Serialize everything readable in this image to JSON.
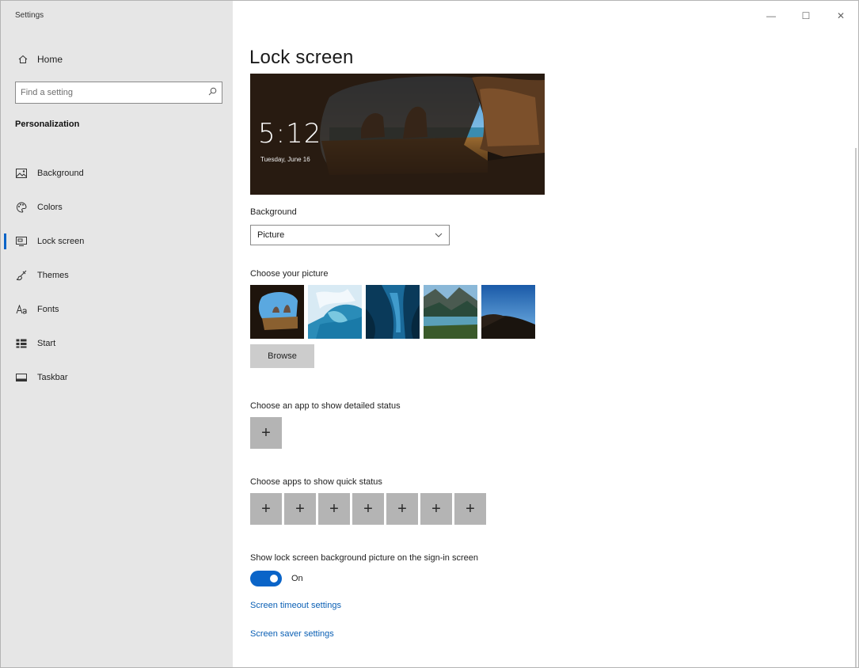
{
  "window": {
    "app_title": "Settings"
  },
  "title_bar": {
    "minimize": "—",
    "maximize": "☐",
    "close": "✕"
  },
  "sidebar": {
    "home_label": "Home",
    "search_placeholder": "Find a setting",
    "section_title": "Personalization",
    "items": [
      {
        "label": "Background",
        "icon": "image-icon"
      },
      {
        "label": "Colors",
        "icon": "palette-icon"
      },
      {
        "label": "Lock screen",
        "icon": "lock-screen-icon",
        "active": true
      },
      {
        "label": "Themes",
        "icon": "brush-icon"
      },
      {
        "label": "Fonts",
        "icon": "font-icon"
      },
      {
        "label": "Start",
        "icon": "start-icon"
      },
      {
        "label": "Taskbar",
        "icon": "taskbar-icon"
      }
    ]
  },
  "main": {
    "title": "Lock screen",
    "preview": {
      "time": "5:12",
      "date": "Tuesday, June 16"
    },
    "background_label": "Background",
    "background_value": "Picture",
    "choose_picture_label": "Choose your picture",
    "browse_label": "Browse",
    "detailed_status_label": "Choose an app to show detailed status",
    "quick_status_label": "Choose apps to show quick status",
    "plus_symbol": "+",
    "show_bg_label": "Show lock screen background picture on the sign-in screen",
    "toggle_state": "On",
    "link_timeout": "Screen timeout settings",
    "link_saver": "Screen saver settings"
  },
  "colors": {
    "accent": "#0a64c8",
    "sidebar_bg": "#e6e6e6",
    "link": "#0a5fb4",
    "button_gray": "#b4b4b4"
  }
}
